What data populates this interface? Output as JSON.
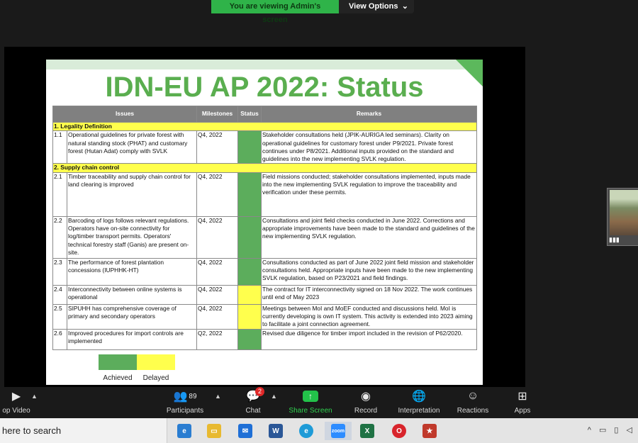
{
  "banner": {
    "viewing_text": "You are viewing Admin's screen",
    "view_options": "View Options"
  },
  "slide": {
    "title": "IDN-EU AP 2022: Status",
    "headers": [
      "Issues",
      "Milestones",
      "Status",
      "Remarks"
    ],
    "sections": [
      {
        "title": "1. Legality Definition",
        "rows": [
          {
            "num": "1.1",
            "issue": "Operational guidelines for private forest with natural standing stock (PHAT) and customary forest (Hutan Adat) comply with SVLK",
            "milestone": "Q4, 2022",
            "status": "achieved",
            "remark": "Stakeholder consultations held (JPIK-AURIGA led seminars). Clarity on operational guidelines  for customary forest under P9/2021. Private forest continues under P8/2021. Additional inputs provided on the  standard and guidelines into the new implementing SVLK regulation."
          }
        ]
      },
      {
        "title": "2. Supply chain control",
        "rows": [
          {
            "num": "2.1",
            "issue": "Timber traceability and supply chain control for land clearing is improved",
            "milestone": "Q4, 2022",
            "status": "achieved",
            "remark": "Field missions conducted; stakeholder consultations implemented, inputs made into the new implementing SVLK regulation to improve the traceability and verification under these permits."
          },
          {
            "num": "2.2",
            "issue": "Barcoding of logs follows relevant regulations. Operators have on-site connectivity for log/timber transport permits. Operators' technical forestry staff (Ganis) are present on-site.",
            "milestone": "Q4, 2022",
            "status": "achieved",
            "remark": "Consultations and joint field checks conducted in June 2022. Corrections and appropriate improvements have been made to the standard and guidelines of the new implementing SVLK regulation."
          },
          {
            "num": "2.3",
            "issue": "The performance of forest plantation concessions (IUPHHK-HT)",
            "milestone": "Q4, 2022",
            "status": "achieved",
            "remark": "Consultations conducted as part of June 2022 joint field mission and stakeholder consultations held. Appropriate inputs have been made to the new implementing SVLK regulation, based on P23/2021 and field findings."
          },
          {
            "num": "2.4",
            "issue": "Interconnectivity between online systems is operational",
            "milestone": "Q4, 2022",
            "status": "delayed",
            "remark": "The contract for IT interconnectivity signed on 18 Nov 2022. The work continues until end of May 2023"
          },
          {
            "num": "2.5",
            "issue": "SIPUHH has comprehensive coverage of primary and secondary operators",
            "milestone": "Q4, 2022",
            "status": "delayed",
            "remark": "Meetings between MoI and MoEF conducted and discussions held. MoI is currently developing is own IT system. This activity is extended into 2023 aiming to facilitate a joint connection agreement."
          },
          {
            "num": "2.6",
            "issue": "Improved procedures for import controls are implemented",
            "milestone": "Q2, 2022",
            "status": "achieved",
            "remark": "Revised due diligence for timber import included in the revision of P62/2020."
          }
        ]
      }
    ],
    "legend": [
      {
        "label": "Achieved",
        "color": "#5cad5c"
      },
      {
        "label": "Delayed",
        "color": "#ffff4d"
      }
    ]
  },
  "toolbar": {
    "video_label": "op Video",
    "participants_label": "Participants",
    "participants_count": "89",
    "chat_label": "Chat",
    "chat_badge": "2",
    "share_label": "Share Screen",
    "record_label": "Record",
    "interpretation_label": "Interpretation",
    "reactions_label": "Reactions",
    "apps_label": "Apps"
  },
  "taskbar": {
    "search_text": "here to search",
    "apps": [
      "edge-icon",
      "file-explorer-icon",
      "mail-icon",
      "word-icon",
      "edge-icon",
      "zoom-icon",
      "excel-icon",
      "opera-icon",
      "app-icon"
    ]
  }
}
